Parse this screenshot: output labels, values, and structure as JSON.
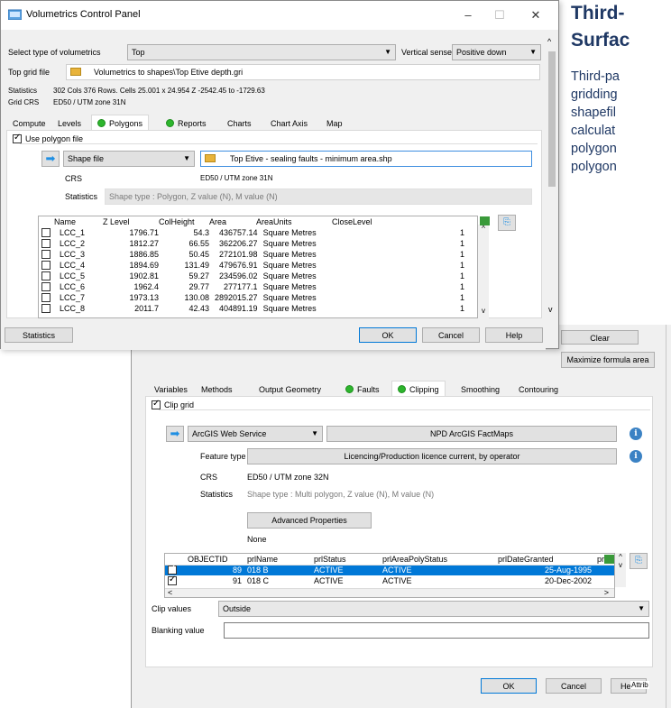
{
  "background_text": {
    "heading_lines": [
      "Third-",
      "Surfac"
    ],
    "para_lines": [
      "Third-pa",
      "gridding",
      "shapefil",
      "calculat",
      "polygon",
      "polygon"
    ]
  },
  "colors": {
    "accent": "#0078d7",
    "green_dot": "#2db52d",
    "heading": "#1f3864",
    "info": "#3b82c4"
  },
  "front_window": {
    "title": "Volumetrics Control Panel",
    "controls": {
      "minimize": "–",
      "maximize": "☐",
      "close": "✕"
    },
    "type_label": "Select type of volumetrics",
    "type_value": "Top",
    "vertical_sense_label": "Vertical sense",
    "vertical_sense_value": "Positive down",
    "top_grid_label": "Top grid file",
    "top_grid_value": "Volumetrics to shapes\\Top Etive depth.gri",
    "statistics_label": "Statistics",
    "statistics_value": "302 Cols 376 Rows. Cells 25.001 x 24.954 Z -2542.45 to -1729.63",
    "grid_crs_label": "Grid CRS",
    "grid_crs_value": "ED50 / UTM zone 31N",
    "tabs": [
      "Compute",
      "Levels",
      "Polygons",
      "Reports",
      "Charts",
      "Chart Axis",
      "Map"
    ],
    "use_polygon_label": "Use polygon file",
    "source_type": "Shape file",
    "shape_file": "Top Etive - sealing faults - minimum area.shp",
    "crs_label": "CRS",
    "crs_value": "ED50 / UTM zone 31N",
    "stats_label": "Statistics",
    "stats_value": "Shape type : Polygon, Z value (N), M value (N)",
    "columns": [
      "Name",
      "Z Level",
      "ColHeight",
      "Area",
      "AreaUnits",
      "CloseLevel"
    ],
    "rows": [
      [
        "LCC_1",
        "1796.71",
        "54.3",
        "436757.14",
        "Square Metres",
        "1"
      ],
      [
        "LCC_2",
        "1812.27",
        "66.55",
        "362206.27",
        "Square Metres",
        "1"
      ],
      [
        "LCC_3",
        "1886.85",
        "50.45",
        "272101.98",
        "Square Metres",
        "1"
      ],
      [
        "LCC_4",
        "1894.69",
        "131.49",
        "479676.91",
        "Square Metres",
        "1"
      ],
      [
        "LCC_5",
        "1902.81",
        "59.27",
        "234596.02",
        "Square Metres",
        "1"
      ],
      [
        "LCC_6",
        "1962.4",
        "29.77",
        "277177.1",
        "Square Metres",
        "1"
      ],
      [
        "LCC_7",
        "1973.13",
        "130.08",
        "2892015.27",
        "Square Metres",
        "1"
      ],
      [
        "LCC_8",
        "2011.7",
        "42.43",
        "404891.19",
        "Square Metres",
        "1"
      ]
    ],
    "statistics_button": "Statistics",
    "ok": "OK",
    "cancel": "Cancel",
    "help": "Help"
  },
  "back_window": {
    "clear_button": "Clear",
    "maximize_button": "Maximize formula area",
    "tabs": [
      "Variables",
      "Methods",
      "Output Geometry",
      "Faults",
      "Clipping",
      "Smoothing",
      "Contouring"
    ],
    "clip_grid_label": "Clip grid",
    "service_value": "ArcGIS Web Service",
    "service_name": "NPD ArcGIS FactMaps",
    "feature_type_label": "Feature type",
    "feature_type_value": "Licencing/Production licence current, by operator",
    "crs_label": "CRS",
    "crs_value": "ED50 / UTM zone 32N",
    "stats_label": "Statistics",
    "stats_value": "Shape type : Multi polygon, Z value (N), M value (N)",
    "advanced_button": "Advanced Properties",
    "none_text": "None",
    "columns": [
      "OBJECTID",
      "prlName",
      "prlStatus",
      "prlAreaPolyStatus",
      "prlDateGranted",
      "prl"
    ],
    "rows": [
      [
        "89",
        "018 B",
        "ACTIVE",
        "ACTIVE",
        "25-Aug-1995"
      ],
      [
        "91",
        "018 C",
        "ACTIVE",
        "ACTIVE",
        "20-Dec-2002"
      ]
    ],
    "clip_values_label": "Clip values",
    "clip_values_value": "Outside",
    "blanking_label": "Blanking value",
    "blanking_value": "",
    "ok": "OK",
    "cancel": "Cancel",
    "help_partial": "Hel",
    "attrib_partial": "Attrib"
  }
}
